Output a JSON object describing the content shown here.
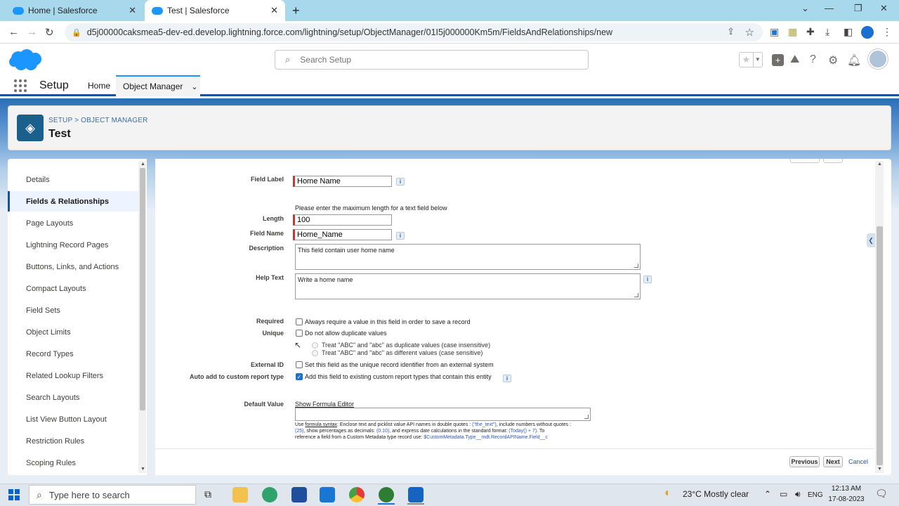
{
  "browser": {
    "tabs": [
      {
        "title": "Home | Salesforce",
        "active": false
      },
      {
        "title": "Test | Salesforce",
        "active": true
      }
    ],
    "url": "d5j00000caksmea5-dev-ed.develop.lightning.force.com/lightning/setup/ObjectManager/01I5j000000Km5m/FieldsAndRelationships/new"
  },
  "header": {
    "search_placeholder": "Search Setup",
    "help_icon": "?"
  },
  "setup_nav": {
    "title": "Setup",
    "home": "Home",
    "object_manager": "Object Manager"
  },
  "page": {
    "breadcrumb": "SETUP > OBJECT MANAGER",
    "title": "Test"
  },
  "sidebar": {
    "items": [
      {
        "label": "Details",
        "active": false
      },
      {
        "label": "Fields & Relationships",
        "active": true
      },
      {
        "label": "Page Layouts",
        "active": false
      },
      {
        "label": "Lightning Record Pages",
        "active": false
      },
      {
        "label": "Buttons, Links, and Actions",
        "active": false
      },
      {
        "label": "Compact Layouts",
        "active": false
      },
      {
        "label": "Field Sets",
        "active": false
      },
      {
        "label": "Object Limits",
        "active": false
      },
      {
        "label": "Record Types",
        "active": false
      },
      {
        "label": "Related Lookup Filters",
        "active": false
      },
      {
        "label": "Search Layouts",
        "active": false
      },
      {
        "label": "List View Button Layout",
        "active": false
      },
      {
        "label": "Restriction Rules",
        "active": false
      },
      {
        "label": "Scoping Rules",
        "active": false
      }
    ]
  },
  "form": {
    "field_label": {
      "label": "Field Label",
      "value": "Home Name"
    },
    "length_hint": "Please enter the maximum length for a text field below",
    "length": {
      "label": "Length",
      "value": "100"
    },
    "field_name": {
      "label": "Field Name",
      "value": "Home_Name"
    },
    "description": {
      "label": "Description",
      "value": "This field contain user home name"
    },
    "help_text": {
      "label": "Help Text",
      "value": "Write a home name"
    },
    "required": {
      "label": "Required",
      "text": "Always require a value in this field in order to save a record",
      "checked": false
    },
    "unique": {
      "label": "Unique",
      "text": "Do not allow duplicate values",
      "checked": false
    },
    "unique_opt1": "Treat \"ABC\" and \"abc\" as duplicate values (case insensitive)",
    "unique_opt2": "Treat \"ABC\" and \"abc\" as different values (case sensitive)",
    "external_id": {
      "label": "External ID",
      "text": "Set this field as the unique record identifier from an external system",
      "checked": false
    },
    "auto_add": {
      "label": "Auto add to custom report type",
      "text": "Add this field to existing custom report types that contain this entity",
      "checked": true
    },
    "default_value": {
      "label": "Default Value",
      "link": "Show Formula Editor",
      "value": ""
    },
    "help_line1_a": "Use ",
    "help_line1_link": "formula syntax",
    "help_line1_b": ": Enclose text and picklist value API names in double quotes : ",
    "help_line1_code": "(\"the_text\")",
    "help_line1_c": ", include numbers without quotes :",
    "help_line2_code1": "(25)",
    "help_line2_a": ", show percentages as decimals: ",
    "help_line2_code2": "(0.10)",
    "help_line2_b": ", and express date calculations in the standard format: ",
    "help_line2_code3": "(Today() + 7)",
    "help_line2_c": ". To",
    "help_line3_a": "reference a field from a Custom Metadata type record use: ",
    "help_line3_code": "$CustomMetadata.Type__mdt.RecordAPIName.Field__c",
    "buttons": {
      "previous": "Previous",
      "next": "Next",
      "cancel": "Cancel"
    }
  },
  "taskbar": {
    "search_placeholder": "Type here to search",
    "weather": "23°C  Mostly clear",
    "lang": "ENG",
    "time": "12:13 AM",
    "date": "17-08-2023"
  }
}
